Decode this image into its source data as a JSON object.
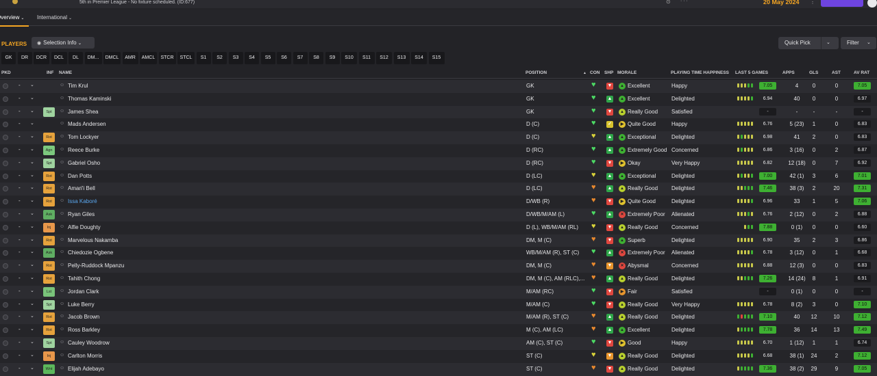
{
  "header": {
    "status_text": "5th in Premier League - No fixture scheduled. (ID:677)",
    "date": "20 May 2024"
  },
  "tabs": [
    {
      "label": "Overview",
      "active": true
    },
    {
      "label": "International",
      "active": false
    }
  ],
  "toolbar": {
    "title": "PLAYERS",
    "selection_info": "Selection Info",
    "quick_pick": "Quick Pick",
    "filter": "Filter"
  },
  "position_filters": [
    "GK",
    "DR",
    "DCR",
    "DCL",
    "DL",
    "DM...",
    "DMCL",
    "AMR",
    "AMCL",
    "STCR",
    "STCL",
    "S1",
    "S2",
    "S3",
    "S4",
    "S5",
    "S6",
    "S7",
    "S8",
    "S9",
    "S10",
    "S11",
    "S12",
    "S13",
    "S14",
    "S15"
  ],
  "columns": {
    "pkd": "PKD",
    "inf": "INF",
    "name": "NAME",
    "position": "POSITION",
    "con": "CON",
    "shp": "SHP",
    "morale": "MORALE",
    "playing_time": "PLAYING TIME HAPPINESS",
    "last5": "LAST 5 GAMES",
    "apps": "APPS",
    "gls": "GLS",
    "ast": "AST",
    "avrat": "AV RAT"
  },
  "players": [
    {
      "inf": "",
      "name": "Tim Krul",
      "position": "GK",
      "con": "green",
      "shp": "down",
      "morale": "Excellent",
      "morale_color": "green",
      "pth": "Happy",
      "bars": [
        "y",
        "y",
        "y",
        "g",
        "g"
      ],
      "last5": "7.05",
      "last5_hi": true,
      "apps": "4",
      "gls": "0",
      "ast": "0",
      "avrat": "7.05",
      "avrat_hi": true
    },
    {
      "inf": "",
      "name": "Thomas Kaminski",
      "position": "GK",
      "con": "green",
      "shp": "up",
      "morale": "Excellent",
      "morale_color": "green",
      "pth": "Delighted",
      "bars": [
        "y",
        "y",
        "y",
        "y",
        "g"
      ],
      "last5": "6.94",
      "last5_hi": false,
      "apps": "40",
      "gls": "0",
      "ast": "0",
      "avrat": "6.97",
      "avrat_hi": false
    },
    {
      "inf": "Spt",
      "inf_type": "spt",
      "name": "James Shea",
      "position": "GK",
      "con": "green",
      "shp": "down",
      "morale": "Really Good",
      "morale_color": "yellowgreen",
      "pth": "Satisfied",
      "bars": [],
      "last5": "-",
      "last5_hi": false,
      "apps": "-",
      "gls": "-",
      "ast": "-",
      "avrat": "-",
      "avrat_hi": false
    },
    {
      "inf": "",
      "name": "Mads Andersen",
      "position": "D (C)",
      "con": "green",
      "shp": "check",
      "morale": "Quite Good",
      "morale_color": "yellow",
      "pth": "Happy",
      "bars": [
        "y",
        "y",
        "y",
        "y",
        "y"
      ],
      "last5": "6.76",
      "last5_hi": false,
      "apps": "5 (23)",
      "gls": "1",
      "ast": "0",
      "avrat": "6.83",
      "avrat_hi": false
    },
    {
      "inf": "Rot",
      "inf_type": "rot",
      "name": "Tom Lockyer",
      "position": "D (C)",
      "con": "yellow",
      "shp": "up",
      "morale": "Exceptional",
      "morale_color": "green",
      "pth": "Delighted",
      "bars": [
        "y",
        "g",
        "y",
        "y",
        "y"
      ],
      "last5": "6.98",
      "last5_hi": false,
      "apps": "41",
      "gls": "2",
      "ast": "0",
      "avrat": "6.83",
      "avrat_hi": false
    },
    {
      "inf": "Agn",
      "inf_type": "agn",
      "name": "Reece Burke",
      "position": "D (RC)",
      "con": "green",
      "shp": "up",
      "morale": "Extremely Good",
      "morale_color": "green",
      "pth": "Concerned",
      "bars": [
        "y",
        "g",
        "y",
        "y",
        "y"
      ],
      "last5": "6.86",
      "last5_hi": false,
      "apps": "3 (16)",
      "gls": "0",
      "ast": "2",
      "avrat": "6.87",
      "avrat_hi": false
    },
    {
      "inf": "Spt",
      "inf_type": "spt",
      "name": "Gabriel Osho",
      "position": "D (RC)",
      "con": "green",
      "shp": "down",
      "morale": "Okay",
      "morale_color": "yellow",
      "pth": "Very Happy",
      "bars": [
        "y",
        "y",
        "y",
        "y",
        "y"
      ],
      "last5": "6.82",
      "last5_hi": false,
      "apps": "12 (18)",
      "gls": "0",
      "ast": "7",
      "avrat": "6.92",
      "avrat_hi": false
    },
    {
      "inf": "Rot",
      "inf_type": "rot",
      "name": "Dan Potts",
      "position": "D (LC)",
      "con": "yellow",
      "shp": "up",
      "morale": "Exceptional",
      "morale_color": "green",
      "pth": "Delighted",
      "bars": [
        "y",
        "g",
        "y",
        "y",
        "g"
      ],
      "last5": "7.00",
      "last5_hi": true,
      "apps": "42 (1)",
      "gls": "3",
      "ast": "6",
      "avrat": "7.01",
      "avrat_hi": true
    },
    {
      "inf": "Rot",
      "inf_type": "rot",
      "name": "Amari'i Bell",
      "position": "D (LC)",
      "con": "orange",
      "shp": "up",
      "morale": "Really Good",
      "morale_color": "yellowgreen",
      "pth": "Delighted",
      "bars": [
        "y",
        "y",
        "g",
        "g",
        "g"
      ],
      "last5": "7.46",
      "last5_hi": true,
      "apps": "38 (3)",
      "gls": "2",
      "ast": "20",
      "avrat": "7.31",
      "avrat_hi": true
    },
    {
      "inf": "Rot",
      "inf_type": "rot",
      "name": "Issa Kaboré",
      "name_link": true,
      "position": "D/WB (R)",
      "con": "orange",
      "shp": "down",
      "morale": "Quite Good",
      "morale_color": "yellow",
      "pth": "Delighted",
      "bars": [
        "y",
        "y",
        "y",
        "y",
        "g"
      ],
      "last5": "6.96",
      "last5_hi": false,
      "apps": "33",
      "gls": "1",
      "ast": "5",
      "avrat": "7.06",
      "avrat_hi": true
    },
    {
      "inf": "Ask",
      "inf_type": "ask",
      "name": "Ryan Giles",
      "position": "D/WB/M/AM (L)",
      "con": "green",
      "shp": "up",
      "morale": "Extremely Poor",
      "morale_color": "red",
      "pth": "Alienated",
      "bars": [
        "y",
        "y",
        "y",
        "g",
        "y"
      ],
      "last5": "6.76",
      "last5_hi": false,
      "apps": "2 (12)",
      "gls": "0",
      "ast": "2",
      "avrat": "6.88",
      "avrat_hi": false
    },
    {
      "inf": "Inj",
      "inf_type": "inj",
      "name": "Alfie Doughty",
      "position": "D (L), WB/M/AM (RL)",
      "con": "yellow",
      "shp": "down",
      "morale": "Really Good",
      "morale_color": "yellowgreen",
      "pth": "Concerned",
      "bars": [
        "y",
        "g",
        "g"
      ],
      "last5": "7.88",
      "last5_hi": true,
      "apps": "0 (1)",
      "gls": "0",
      "ast": "0",
      "avrat": "6.60",
      "avrat_hi": false
    },
    {
      "inf": "Rot",
      "inf_type": "rot",
      "name": "Marvelous Nakamba",
      "position": "DM, M (C)",
      "con": "orange",
      "shp": "down",
      "morale": "Superb",
      "morale_color": "green",
      "pth": "Delighted",
      "bars": [
        "y",
        "y",
        "y",
        "y",
        "y"
      ],
      "last5": "6.90",
      "last5_hi": false,
      "apps": "35",
      "gls": "2",
      "ast": "3",
      "avrat": "6.86",
      "avrat_hi": false
    },
    {
      "inf": "Ask",
      "inf_type": "ask",
      "name": "Chiedozie Ogbene",
      "position": "WB/M/AM (R), ST (C)",
      "con": "green",
      "shp": "up",
      "morale": "Extremely Poor",
      "morale_color": "red",
      "pth": "Alienated",
      "bars": [
        "y",
        "y",
        "y",
        "y",
        "g"
      ],
      "last5": "6.78",
      "last5_hi": false,
      "apps": "3 (12)",
      "gls": "0",
      "ast": "1",
      "avrat": "6.68",
      "avrat_hi": false
    },
    {
      "inf": "Rot",
      "inf_type": "rot",
      "name": "Pelly-Ruddock Mpanzu",
      "position": "DM, M (C)",
      "con": "orange",
      "shp": "ydown",
      "morale": "Abysmal",
      "morale_color": "red",
      "pth": "Concerned",
      "bars": [
        "y",
        "y",
        "y",
        "y",
        "y"
      ],
      "last5": "6.88",
      "last5_hi": false,
      "apps": "12 (3)",
      "gls": "0",
      "ast": "0",
      "avrat": "6.83",
      "avrat_hi": false
    },
    {
      "inf": "Rot",
      "inf_type": "rot",
      "name": "Tahith Chong",
      "position": "DM, M (C), AM (RLC),...",
      "con": "orange",
      "shp": "up",
      "morale": "Really Good",
      "morale_color": "yellowgreen",
      "pth": "Delighted",
      "bars": [
        "y",
        "y",
        "g",
        "g",
        "g"
      ],
      "last5": "7.26",
      "last5_hi": true,
      "apps": "14 (24)",
      "gls": "8",
      "ast": "1",
      "avrat": "6.91",
      "avrat_hi": false
    },
    {
      "inf": "Lst",
      "inf_type": "lst",
      "name": "Jordan Clark",
      "position": "M/AM (RC)",
      "con": "green",
      "shp": "down",
      "morale": "Fair",
      "morale_color": "orange",
      "pth": "Satisfied",
      "bars": [],
      "last5": "-",
      "last5_hi": false,
      "apps": "0 (1)",
      "gls": "0",
      "ast": "0",
      "avrat": "-",
      "avrat_hi": false
    },
    {
      "inf": "Spt",
      "inf_type": "spt",
      "name": "Luke Berry",
      "position": "M/AM (C)",
      "con": "green",
      "shp": "down",
      "morale": "Really Good",
      "morale_color": "yellowgreen",
      "pth": "Very Happy",
      "bars": [
        "y",
        "y",
        "y",
        "y",
        "y"
      ],
      "last5": "6.78",
      "last5_hi": false,
      "apps": "8 (2)",
      "gls": "3",
      "ast": "0",
      "avrat": "7.10",
      "avrat_hi": true
    },
    {
      "inf": "Rot",
      "inf_type": "rot",
      "name": "Jacob Brown",
      "position": "M/AM (R), ST (C)",
      "con": "orange",
      "shp": "up",
      "morale": "Really Good",
      "morale_color": "yellowgreen",
      "pth": "Delighted",
      "bars": [
        "g",
        "r",
        "g",
        "g",
        "g"
      ],
      "last5": "7.10",
      "last5_hi": true,
      "apps": "40",
      "gls": "12",
      "ast": "10",
      "avrat": "7.12",
      "avrat_hi": true
    },
    {
      "inf": "Rot",
      "inf_type": "rot",
      "name": "Ross Barkley",
      "position": "M (C), AM (LC)",
      "con": "orange",
      "shp": "up",
      "morale": "Excellent",
      "morale_color": "green",
      "pth": "Delighted",
      "bars": [
        "y",
        "g",
        "g",
        "g",
        "g"
      ],
      "last5": "7.78",
      "last5_hi": true,
      "apps": "36",
      "gls": "14",
      "ast": "13",
      "avrat": "7.49",
      "avrat_hi": true
    },
    {
      "inf": "Spt",
      "inf_type": "spt",
      "name": "Cauley Woodrow",
      "position": "AM (C), ST (C)",
      "con": "green",
      "shp": "down",
      "morale": "Good",
      "morale_color": "yellow",
      "pth": "Happy",
      "bars": [
        "y",
        "y",
        "y",
        "y",
        "y"
      ],
      "last5": "6.70",
      "last5_hi": false,
      "apps": "1 (12)",
      "gls": "1",
      "ast": "1",
      "avrat": "6.74",
      "avrat_hi": false
    },
    {
      "inf": "Inj",
      "inf_type": "inj",
      "name": "Carlton Morris",
      "position": "ST (C)",
      "con": "yellow",
      "shp": "ydown",
      "morale": "Really Good",
      "morale_color": "yellowgreen",
      "pth": "Delighted",
      "bars": [
        "y",
        "y",
        "y",
        "y",
        "g"
      ],
      "last5": "6.68",
      "last5_hi": false,
      "apps": "38 (1)",
      "gls": "24",
      "ast": "2",
      "avrat": "7.12",
      "avrat_hi": true
    },
    {
      "inf": "Wnt",
      "inf_type": "wnt",
      "name": "Elijah Adebayo",
      "position": "ST (C)",
      "con": "orange",
      "shp": "down",
      "morale": "Really Good",
      "morale_color": "yellowgreen",
      "pth": "Delighted",
      "bars": [
        "y",
        "g",
        "g",
        "g",
        "g"
      ],
      "last5": "7.36",
      "last5_hi": true,
      "apps": "38 (2)",
      "gls": "29",
      "ast": "9",
      "avrat": "7.05",
      "avrat_hi": true
    }
  ],
  "colors": {
    "accent": "#f5a623",
    "highlight_green": "#3eb032",
    "con_green": "#4cd964",
    "con_yellow": "#d8d23a",
    "con_orange": "#e8892e",
    "shp_up_green": "#2fa64a",
    "shp_down_red": "#e0473f",
    "shp_ydown_orange": "#e8962e",
    "shp_check_yellow": "#d8c32e",
    "bar_yellow": "#c8c84a",
    "bar_green": "#3eb032",
    "bar_red": "#e0473f",
    "purple_button": "#6e44e0"
  }
}
